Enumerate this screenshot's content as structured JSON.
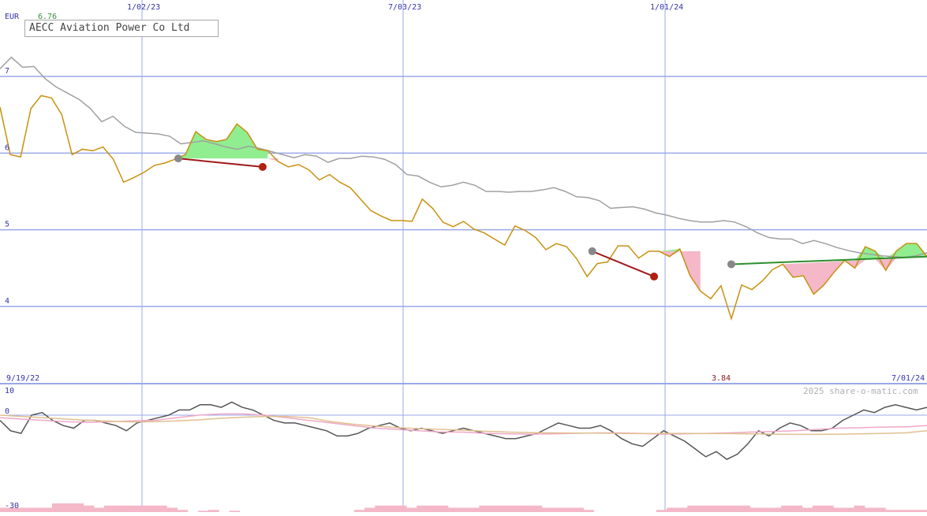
{
  "title": "AECC Aviation Power Co Ltd",
  "currency": "EUR",
  "first_value": "6.76",
  "min_label": "3.84",
  "start_date": "9/19/22",
  "end_date": "7/01/24",
  "copyright": "2025 share-o-matic.com",
  "colors": {
    "price": "#c8900f",
    "average": "#a0a0a0",
    "grid": "#9aa8e8",
    "gain_fill": "#90ee90",
    "loss_fill": "#f4b8c8",
    "buy_line": "#2d8f2d",
    "sell_line": "#a01818",
    "marker_gray": "#888888",
    "marker_red": "#b02010",
    "osc_main": "#555555",
    "osc_pink": "#f0a8c8",
    "osc_tan": "#e0c090",
    "volume": "#f4b8c8",
    "green_text": "#3a8f3a"
  },
  "chart_data": [
    {
      "type": "line",
      "title": "AECC Aviation Power Co Ltd",
      "ylabel": "EUR",
      "ylim": [
        3.0,
        7.9
      ],
      "x_ticks": [
        "1/02/23",
        "7/03/23",
        "1/01/24"
      ],
      "y_ticks": [
        4,
        5,
        6,
        7
      ],
      "grid": true,
      "series": [
        {
          "key": "price",
          "values": [
            6.6,
            5.98,
            5.95,
            6.58,
            6.75,
            6.72,
            6.5,
            5.98,
            6.05,
            6.03,
            6.08,
            5.92,
            5.62,
            5.68,
            5.75,
            5.84,
            5.87,
            5.92,
            5.98,
            6.28,
            6.18,
            6.15,
            6.18,
            6.38,
            6.27,
            6.05,
            6.03,
            5.89,
            5.82,
            5.85,
            5.78,
            5.65,
            5.72,
            5.62,
            5.55,
            5.4,
            5.25,
            5.18,
            5.12,
            5.12,
            5.11,
            5.4,
            5.28,
            5.1,
            5.04,
            5.11,
            5.01,
            4.96,
            4.88,
            4.8,
            5.05,
            4.99,
            4.9,
            4.74,
            4.82,
            4.78,
            4.62,
            4.39,
            4.56,
            4.58,
            4.79,
            4.79,
            4.63,
            4.72,
            4.72,
            4.65,
            4.75,
            4.4,
            4.2,
            4.1,
            4.27,
            3.84,
            4.28,
            4.22,
            4.33,
            4.48,
            4.55,
            4.38,
            4.4,
            4.16,
            4.28,
            4.45,
            4.6,
            4.5,
            4.78,
            4.72,
            4.47,
            4.72,
            4.82,
            4.82,
            4.65
          ]
        },
        {
          "key": "average",
          "values": [
            7.1,
            7.25,
            7.12,
            7.13,
            6.97,
            6.86,
            6.78,
            6.7,
            6.58,
            6.41,
            6.48,
            6.35,
            6.27,
            6.26,
            6.25,
            6.22,
            6.12,
            6.14,
            6.16,
            6.12,
            6.08,
            6.05,
            6.09,
            6.06,
            6.02,
            5.98,
            5.94,
            5.98,
            5.96,
            5.88,
            5.93,
            5.93,
            5.96,
            5.95,
            5.92,
            5.85,
            5.72,
            5.7,
            5.62,
            5.56,
            5.58,
            5.62,
            5.58,
            5.5,
            5.5,
            5.49,
            5.5,
            5.5,
            5.52,
            5.55,
            5.5,
            5.43,
            5.42,
            5.38,
            5.28,
            5.29,
            5.3,
            5.27,
            5.22,
            5.19,
            5.15,
            5.12,
            5.1,
            5.1,
            5.12,
            5.1,
            5.04,
            4.96,
            4.9,
            4.88,
            4.88,
            4.82,
            4.86,
            4.82,
            4.77,
            4.73,
            4.7,
            4.68,
            4.66,
            4.65,
            4.64,
            4.66,
            4.7
          ]
        }
      ],
      "signals": [
        {
          "kind": "sell",
          "from": 5.93,
          "to": 5.82
        },
        {
          "kind": "sell",
          "from": 4.72,
          "to": 4.39
        },
        {
          "kind": "buy",
          "from": 4.55,
          "to": 4.65
        }
      ]
    },
    {
      "type": "line",
      "title": "",
      "ylim": [
        -30,
        10
      ],
      "y_ticks": [
        10,
        0,
        -30
      ],
      "series": [
        {
          "key": "osc_main",
          "values": [
            -2,
            -6,
            -7,
            0,
            1,
            -2,
            -4,
            -5,
            -2,
            -2,
            -3,
            -4,
            -6,
            -3,
            -2,
            -1,
            0,
            2,
            2,
            4,
            4,
            3,
            5,
            3,
            2,
            0,
            -2,
            -3,
            -3,
            -4,
            -5,
            -6,
            -8,
            -8,
            -7,
            -5,
            -4,
            -3,
            -5,
            -6,
            -5,
            -6,
            -7,
            -6,
            -5,
            -6,
            -7,
            -8,
            -9,
            -9,
            -8,
            -7,
            -5,
            -3,
            -4,
            -5,
            -5,
            -4,
            -6,
            -9,
            -11,
            -12,
            -9,
            -6,
            -8,
            -10,
            -13,
            -16,
            -14,
            -17,
            -15,
            -11,
            -6,
            -8,
            -5,
            -3,
            -4,
            -6,
            -6,
            -5,
            -2,
            0,
            2,
            1,
            3,
            4,
            3,
            2,
            3
          ]
        },
        {
          "key": "osc_pink",
          "values": [
            -1,
            -1.5,
            -2,
            -2.5,
            -2.8,
            -2.5,
            -2.2,
            -2,
            -1,
            0,
            0.5,
            0.5,
            0,
            -1,
            -2,
            -3,
            -4,
            -5,
            -5.5,
            -6,
            -6.5,
            -6.5,
            -7,
            -7.2,
            -7.3,
            -7.2,
            -7,
            -6.8,
            -6.8,
            -7,
            -7.3,
            -7.2,
            -7,
            -6.8,
            -6.5,
            -6.3,
            -6,
            -5.5,
            -5,
            -4.8,
            -4.6,
            -4.5,
            -4
          ]
        },
        {
          "key": "osc_tan",
          "values": [
            0,
            -0.5,
            -1,
            -1.5,
            -2,
            -2.3,
            -2.6,
            -2.5,
            -2.2,
            -1.8,
            -1.2,
            -0.8,
            -0.5,
            -0.5,
            -1,
            -2.5,
            -3.5,
            -4.2,
            -4.8,
            -5.2,
            -5.5,
            -5.8,
            -6.2,
            -6.5,
            -6.7,
            -6.8,
            -6.9,
            -6.9,
            -7,
            -7.1,
            -7,
            -7,
            -7.1,
            -7.1,
            -7.2,
            -7.3,
            -7.4,
            -7.4,
            -7.3,
            -7.2,
            -7,
            -6.8,
            -6
          ]
        }
      ]
    },
    {
      "type": "bar",
      "title": "",
      "values": [
        1,
        1,
        1,
        1,
        1,
        2,
        2,
        2,
        1.5,
        1,
        1.5,
        1.5,
        1.5,
        1.5,
        1.5,
        1.5,
        1,
        0.5,
        0,
        0.3,
        0.5,
        0,
        0.3,
        0,
        0,
        0,
        0,
        0,
        0,
        0,
        0,
        0,
        0,
        0,
        0.5,
        1,
        1.5,
        1.5,
        1.5,
        1,
        1.5,
        1.5,
        1.5,
        1,
        1,
        1,
        1.5,
        1.5,
        1.5,
        1.5,
        1.5,
        1.5,
        1,
        1,
        1,
        1,
        0.5,
        0,
        0,
        0,
        0,
        0,
        0,
        0.5,
        1,
        1,
        1.5,
        1.5,
        1.5,
        1.5,
        1.5,
        1.5,
        1,
        1,
        1,
        1.5,
        1.5,
        1,
        1.5,
        1.5,
        1,
        1,
        1.5,
        1,
        1,
        0.5,
        0.5,
        0.5,
        0.5
      ]
    }
  ]
}
